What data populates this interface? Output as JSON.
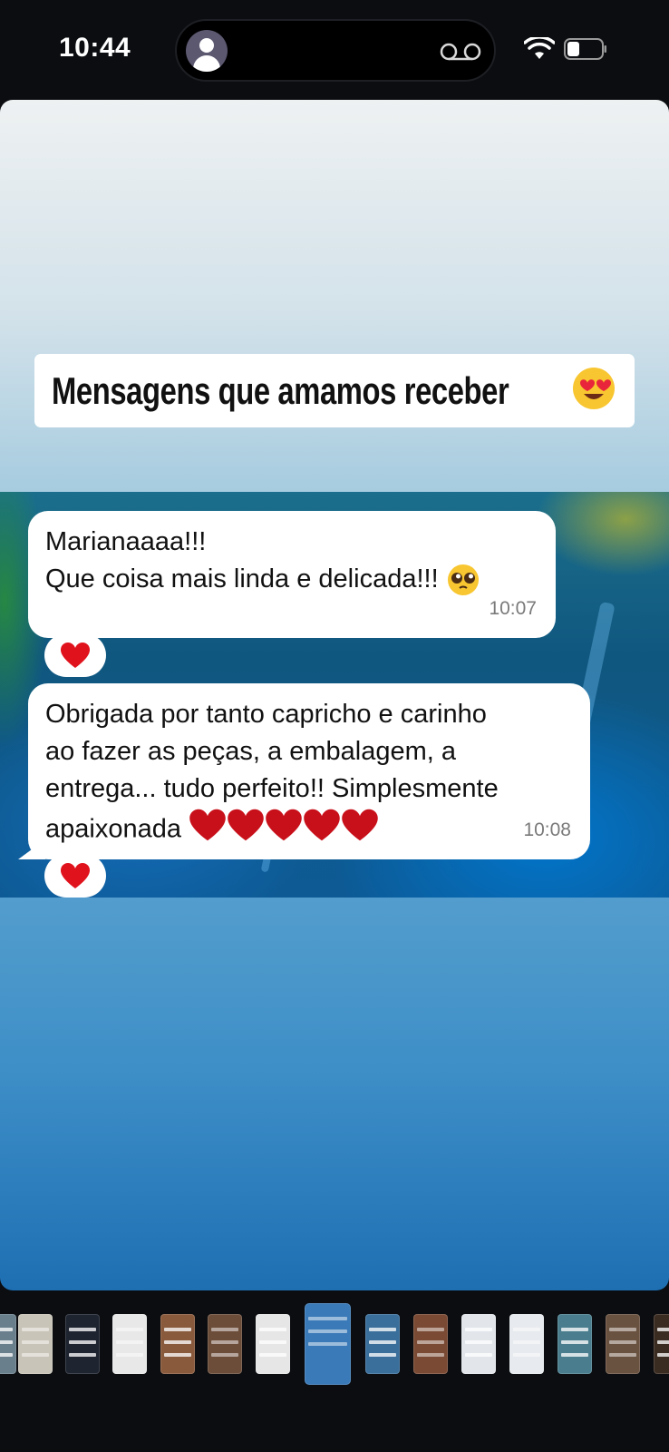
{
  "status_bar": {
    "time": "10:44",
    "icons": [
      "contact-avatar-icon",
      "voicemail-icon",
      "wifi-icon",
      "battery-icon"
    ]
  },
  "story": {
    "headline": "Mensagens que amamos receber",
    "headline_emoji": "smiling-face-with-heart-eyes",
    "messages": [
      {
        "lines": [
          "Marianaaaa!!!",
          "Que coisa mais linda e delicada!!!"
        ],
        "emoji": "pleading-face",
        "time": "10:07",
        "reaction": "red-heart"
      },
      {
        "lines": [
          "Obrigada por tanto capricho e carinho",
          "ao fazer as peças, a embalagem, a",
          "entrega... tudo perfeito!! Simplesmente",
          "apaixonada"
        ],
        "emoji": "red-heart x5",
        "time": "10:08",
        "reaction": "red-heart"
      }
    ]
  },
  "thumbnails": {
    "count": 15,
    "active_index": 6,
    "colors": [
      "#6a7f8c",
      "#c9c4b8",
      "#1e2430",
      "#e8e8e8",
      "#8a5a3c",
      "#6c4d3a",
      "#e6e6e6",
      "#3a7ab8",
      "#3a6f9c",
      "#7a4a34",
      "#e2e6ea",
      "#e7eaee",
      "#4a7e8e",
      "#6a5240",
      "#3b2c22"
    ]
  },
  "colors": {
    "headline_bg": "#ffffff",
    "bubble_bg": "#ffffff",
    "timestamp": "#7a7a7a",
    "heart": "#e0121c"
  }
}
